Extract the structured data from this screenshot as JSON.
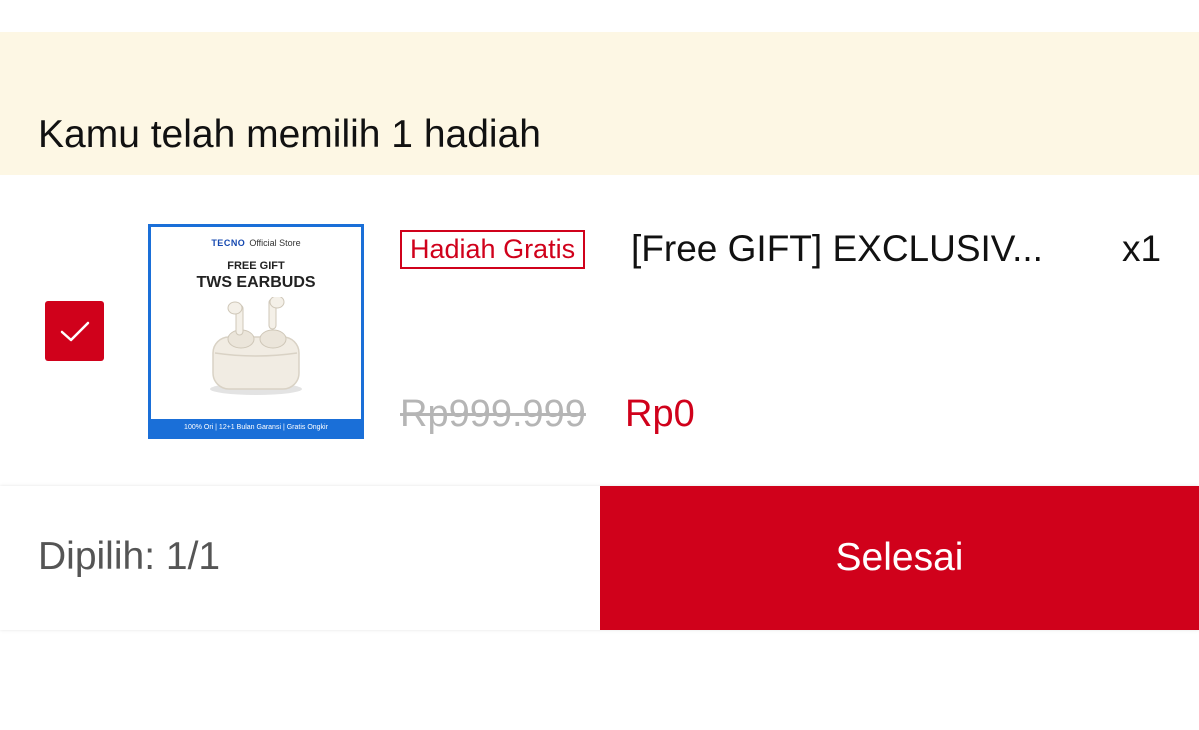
{
  "banner": {
    "text": "Kamu telah memilih 1 hadiah"
  },
  "item": {
    "checked": true,
    "badge": "Hadiah Gratis",
    "name": "[Free GIFT] EXCLUSIV...",
    "quantity": "x1",
    "original_price": "Rp999.999",
    "price": "Rp0",
    "image": {
      "brand": "TECNO",
      "store": "Official Store",
      "line1": "FREE GIFT",
      "line2": "TWS EARBUDS",
      "footer": "100% Ori | 12+1 Bulan Garansi | Gratis Ongkir",
      "icon": "earbuds-icon"
    }
  },
  "footer": {
    "selected": "Dipilih: 1/1",
    "done_label": "Selesai"
  },
  "colors": {
    "accent": "#d0011b",
    "banner_bg": "#fdf7e4",
    "strike_price": "#b5b5b5",
    "image_border": "#1a6fd8"
  }
}
